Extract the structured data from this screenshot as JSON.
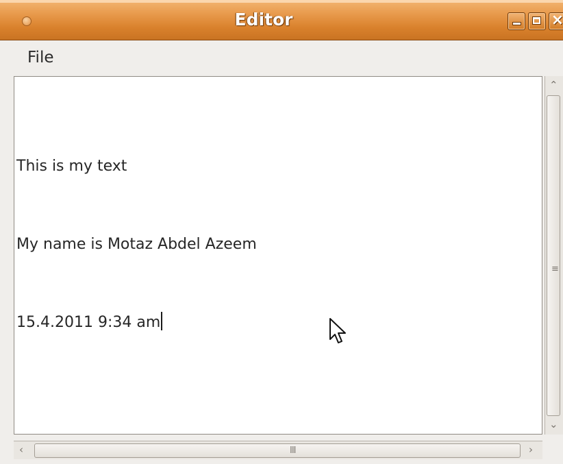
{
  "window": {
    "title": "Editor",
    "controls": {
      "minimize_icon": "minimize-icon",
      "maximize_icon": "maximize-icon",
      "close_icon": "close-icon",
      "close_glyph": "×"
    }
  },
  "menubar": {
    "items": [
      {
        "label": "File"
      }
    ]
  },
  "editor": {
    "lines": [
      "This is my text",
      "My name is Motaz Abdel Azeem",
      "15.4.2011 9:34 am"
    ]
  },
  "scrollbars": {
    "vertical_grip": "≡",
    "horizontal_grip": "III"
  },
  "colors": {
    "titlebar_accent": "#d9812c",
    "window_bg": "#f0eeeb",
    "editor_bg": "#ffffff"
  }
}
